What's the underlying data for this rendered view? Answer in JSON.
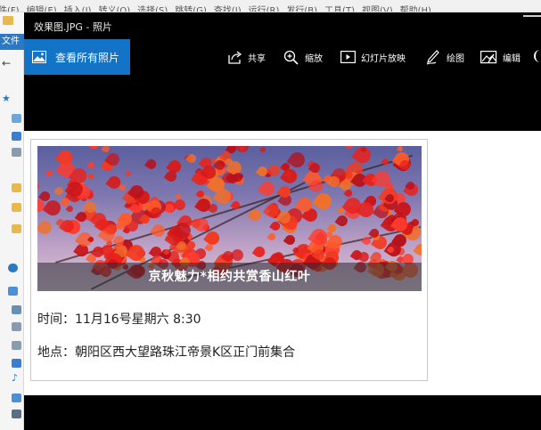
{
  "background_editor": {
    "menu_items": [
      "件(F)",
      "编辑(E)",
      "插入(I)",
      "转义(O)",
      "选择(S)",
      "跳转(G)",
      "查找(I)",
      "运行(R)",
      "发行(B)",
      "工具(T)",
      "视图(V)",
      "帮助(H)"
    ],
    "file_tab_label": "文件"
  },
  "window": {
    "title": "效果图.JPG - 照片"
  },
  "command_bar": {
    "view_all_label": "查看所有照片",
    "share_label": "共享",
    "zoom_label": "缩放",
    "slideshow_label": "幻灯片放映",
    "draw_label": "绘图",
    "edit_label": "编辑",
    "accent_color": "#1273c7"
  },
  "document": {
    "banner_caption": "京秋魅力*相约共赏香山红叶",
    "time_line": "时间：11月16号星期六 8:30",
    "location_line": "地点：朝阳区西大望路珠江帝景K区正门前集合"
  }
}
